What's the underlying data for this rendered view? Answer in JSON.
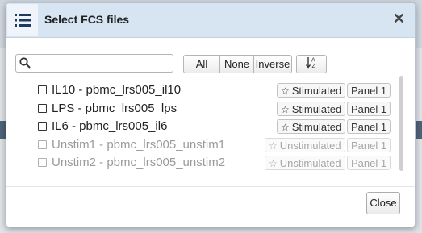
{
  "dialog": {
    "title": "Select FCS files",
    "close_symbol": "✕",
    "close_label": "Close"
  },
  "toolbar": {
    "search_placeholder": "",
    "search_value": "",
    "filter_buttons": [
      "All",
      "None",
      "Inverse"
    ],
    "sort_icon": "sort-alpha-icon"
  },
  "files": [
    {
      "label": "IL10 - pbmc_lrs005_il10",
      "condition": "Stimulated",
      "panel": "Panel 1",
      "enabled": true
    },
    {
      "label": "LPS - pbmc_lrs005_lps",
      "condition": "Stimulated",
      "panel": "Panel 1",
      "enabled": true
    },
    {
      "label": "IL6 - pbmc_lrs005_il6",
      "condition": "Stimulated",
      "panel": "Panel 1",
      "enabled": true
    },
    {
      "label": "Unstim1 - pbmc_lrs005_unstim1",
      "condition": "Unstimulated",
      "panel": "Panel 1",
      "enabled": false
    },
    {
      "label": "Unstim2 - pbmc_lrs005_unstim2",
      "condition": "Unstimulated",
      "panel": "Panel 1",
      "enabled": false
    }
  ],
  "colors": {
    "header_bg": "#d7e5f3",
    "icon_color": "#1f3a5f"
  }
}
